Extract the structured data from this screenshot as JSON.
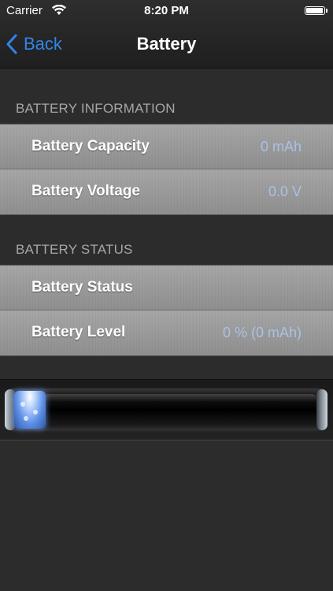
{
  "status_bar": {
    "carrier": "Carrier",
    "time": "8:20 PM",
    "wifi_icon": "wifi-icon",
    "battery_icon": "battery-icon"
  },
  "nav": {
    "back_label": "Back",
    "back_icon": "chevron-left-icon",
    "title": "Battery",
    "accent_color": "#2f86e8"
  },
  "sections": {
    "info": {
      "header": "BATTERY INFORMATION",
      "rows": [
        {
          "label": "Battery Capacity",
          "value": "0 mAh"
        },
        {
          "label": "Battery Voltage",
          "value": "0.0 V"
        }
      ]
    },
    "status": {
      "header": "BATTERY STATUS",
      "rows": [
        {
          "label": "Battery Status",
          "value": ""
        },
        {
          "label": "Battery Level",
          "value": "0 % (0 mAh)"
        }
      ]
    }
  },
  "gauge": {
    "level_fraction": 0.0,
    "fill_color": "#5d8fe6"
  }
}
